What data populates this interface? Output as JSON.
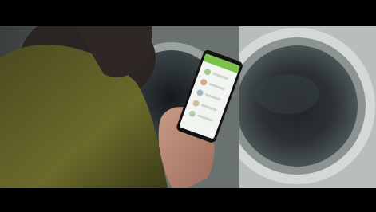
{
  "scene": {
    "description_labels": {
      "person": "person",
      "phone": "smartphone",
      "washing_machine_left": "washing-machine-left",
      "washing_machine_right": "washing-machine-right"
    },
    "colors": {
      "app_header": "#7cc14a",
      "phone_screen": "#f2f4f1",
      "jacket": "#6e6a2a",
      "skin": "#b98673",
      "machine_metal": "#c7cdcb"
    }
  }
}
